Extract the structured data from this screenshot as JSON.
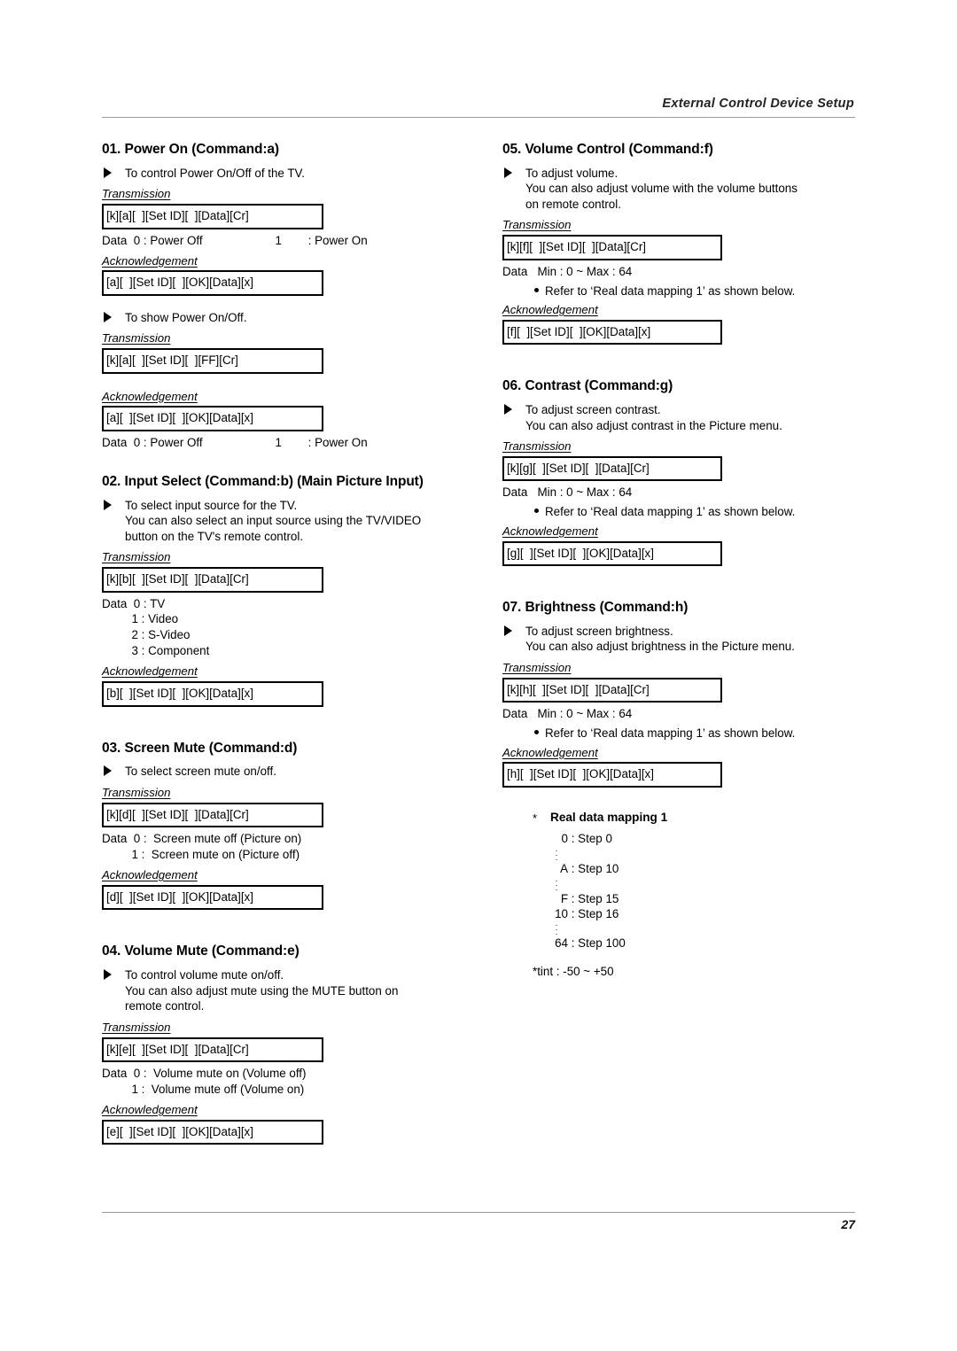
{
  "header": {
    "title": "External Control Device Setup"
  },
  "footer": {
    "page_number": "27"
  },
  "left_column": {
    "sections": [
      {
        "title": "01. Power On (Command:a)",
        "bullet1_line1": "To control Power On/Off of the TV.",
        "transmission_label": "Transmission",
        "transmission_box": "[k][a][  ][Set ID][  ][Data][Cr]",
        "data_line": "Data  0 : Power Off                      1        : Power On",
        "ack_label": "Acknowledgement",
        "ack_box": "[a][  ][Set ID][  ][OK][Data][x]",
        "bullet2_line1": "To show Power On/Off.",
        "transmission2_label": "Transmission",
        "transmission2_box": "[k][a][  ][Set ID][  ][FF][Cr]",
        "ack2_label": "Acknowledgement",
        "ack2_box": "[a][  ][Set ID][  ][OK][Data][x]",
        "data_line2": "Data  0 : Power Off                      1        : Power On"
      },
      {
        "title": "02. Input Select (Command:b) (Main Picture Input)",
        "bullet_line1": "To select input source for the TV.",
        "bullet_line2": "You can also select an input source using the TV/VIDEO",
        "bullet_line3": "button on the TV's remote control.",
        "transmission_label": "Transmission",
        "transmission_box": "[k][b][  ][Set ID][  ][Data][Cr]",
        "data_lines": [
          "Data  0 : TV",
          "         1 : Video",
          "         2 : S-Video",
          "         3 : Component"
        ],
        "ack_label": "Acknowledgement",
        "ack_box": "[b][  ][Set ID][  ][OK][Data][x]"
      },
      {
        "title": "03. Screen Mute (Command:d)",
        "bullet_line1": "To select screen mute on/off.",
        "transmission_label": "Transmission",
        "transmission_box": "[k][d][  ][Set ID][  ][Data][Cr]",
        "data_lines": [
          "Data  0 :  Screen mute off (Picture on)",
          "         1 :  Screen mute on (Picture off)"
        ],
        "ack_label": "Acknowledgement",
        "ack_box": "[d][  ][Set ID][  ][OK][Data][x]"
      },
      {
        "title": "04. Volume Mute (Command:e)",
        "bullet_line1": "To control volume mute on/off.",
        "bullet_line2": "You can also adjust mute using the MUTE button on",
        "bullet_line3": "remote control.",
        "transmission_label": "Transmission",
        "transmission_box": "[k][e][  ][Set ID][  ][Data][Cr]",
        "data_lines": [
          "Data  0 :  Volume mute on (Volume off)",
          "         1 :  Volume mute off (Volume on)"
        ],
        "ack_label": "Acknowledgement",
        "ack_box": "[e][  ][Set ID][  ][OK][Data][x]"
      }
    ]
  },
  "right_column": {
    "sections": [
      {
        "title": "05. Volume Control (Command:f)",
        "bullet_line1": "To adjust volume.",
        "bullet_line2": "You can also adjust volume with the volume buttons",
        "bullet_line3": "on remote control.",
        "transmission_label": "Transmission",
        "transmission_box": "[k][f][  ][Set ID][  ][Data][Cr]",
        "data_line": "Data   Min : 0 ~ Max : 64",
        "ref_line": "Refer to ‘Real data mapping 1’ as shown below.",
        "ack_label": "Acknowledgement",
        "ack_box": "[f][  ][Set ID][  ][OK][Data][x]"
      },
      {
        "title": "06. Contrast (Command:g)",
        "bullet_line1": "To adjust screen contrast.",
        "bullet_line2": "You can also adjust contrast in the Picture menu.",
        "transmission_label": "Transmission",
        "transmission_box": "[k][g][  ][Set ID][  ][Data][Cr]",
        "data_line": "Data   Min : 0 ~ Max : 64",
        "ref_line": "Refer to ‘Real data mapping 1’ as shown below.",
        "ack_label": "Acknowledgement",
        "ack_box": "[g][  ][Set ID][  ][OK][Data][x]"
      },
      {
        "title": "07. Brightness (Command:h)",
        "bullet_line1": "To adjust screen brightness.",
        "bullet_line2": "You can also adjust brightness in the Picture menu.",
        "transmission_label": "Transmission",
        "transmission_box": "[k][h][  ][Set ID][  ][Data][Cr]",
        "data_line": "Data   Min : 0 ~ Max : 64",
        "ref_line": "Refer to ‘Real data mapping 1’ as shown below.",
        "ack_label": "Acknowledgement",
        "ack_box": "[h][  ][Set ID][  ][OK][Data][x]"
      }
    ],
    "real_data_mapping": {
      "star": "*",
      "title": "Real data mapping 1",
      "rows": [
        {
          "key": "0",
          "value": ": Step 0"
        },
        {
          "key": "A",
          "value": ": Step 10"
        },
        {
          "key": "F",
          "value": ": Step 15"
        },
        {
          "key": "10",
          "value": ": Step 16"
        },
        {
          "key": "64",
          "value": ": Step 100"
        }
      ],
      "tint_note": "*tint : -50 ~ +50"
    }
  }
}
